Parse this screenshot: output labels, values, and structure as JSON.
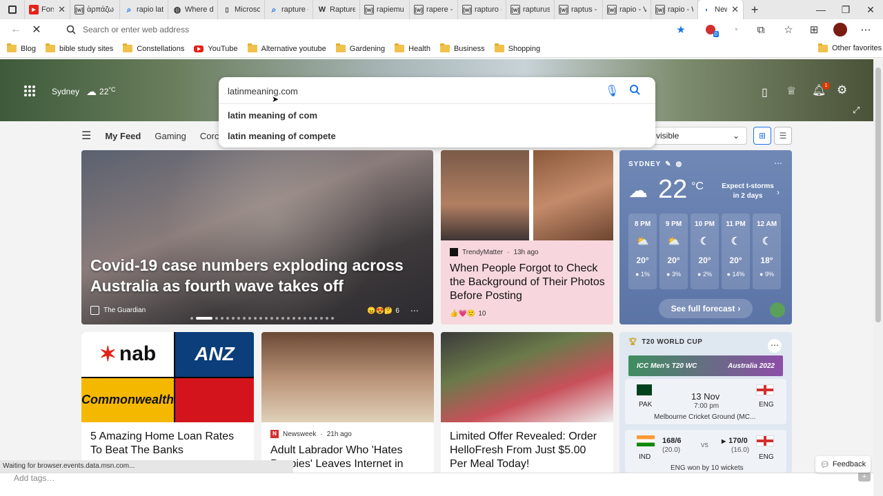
{
  "tabs": [
    {
      "icon": "youtube-icon",
      "title": "Fors",
      "color": "#e62117"
    },
    {
      "icon": "wiktionary-icon",
      "title": "ἁρπάζω"
    },
    {
      "icon": "search-icon",
      "title": "rapio lat"
    },
    {
      "icon": "globe-icon",
      "title": "Where d"
    },
    {
      "icon": "page-icon",
      "title": "Microsof"
    },
    {
      "icon": "search-icon",
      "title": "rapture -"
    },
    {
      "icon": "wikipedia-icon",
      "title": "Rapture"
    },
    {
      "icon": "wiktionary-icon",
      "title": "rapiemu"
    },
    {
      "icon": "wiktionary-icon",
      "title": "rapere -"
    },
    {
      "icon": "wiktionary-icon",
      "title": "rapturo -"
    },
    {
      "icon": "wiktionary-icon",
      "title": "rapturus"
    },
    {
      "icon": "wiktionary-icon",
      "title": "raptus -"
    },
    {
      "icon": "wiktionary-icon",
      "title": "rapio - V"
    },
    {
      "icon": "wiktionary-icon",
      "title": "rapio - W"
    }
  ],
  "active_tab": {
    "title": "New",
    "close": "✕"
  },
  "new_tab": "+",
  "window": {
    "minimize": "—",
    "restore": "❐",
    "close": "✕"
  },
  "address": {
    "placeholder": "Search or enter web address",
    "ext_badge": "0"
  },
  "bookmarks": [
    {
      "label": "Blog",
      "icon": "folder"
    },
    {
      "label": "bible study sites",
      "icon": "folder"
    },
    {
      "label": "Constellations",
      "icon": "folder"
    },
    {
      "label": "YouTube",
      "icon": "youtube"
    },
    {
      "label": "Alternative youtube",
      "icon": "folder"
    },
    {
      "label": "Gardening",
      "icon": "folder"
    },
    {
      "label": "Health",
      "icon": "folder"
    },
    {
      "label": "Business",
      "icon": "folder"
    },
    {
      "label": "Shopping",
      "icon": "folder"
    }
  ],
  "other_favorites": "Other favorites",
  "header_weather": {
    "city": "Sydney",
    "temp": "22",
    "unit": "°C"
  },
  "notifications_badge": "1",
  "search": {
    "value": "latinmeaning.com",
    "suggestions": [
      "latin meaning of com",
      "latin meaning of compete"
    ]
  },
  "feed_nav": {
    "items": [
      "My Feed",
      "Gaming",
      "Corc"
    ],
    "visible_label": "visible"
  },
  "big_card": {
    "title": "Covid-19 case numbers exploding across Australia as fourth wave takes off",
    "source": "The Guardian",
    "reactions": "6"
  },
  "pink_card": {
    "source": "TrendyMatter",
    "time": "13h ago",
    "title": "When People Forgot to Check the Background of Their Photos Before Posting",
    "reactions": "10"
  },
  "weather_card": {
    "city": "SYDNEY",
    "temp": "22",
    "unit": "°C",
    "alert": "Expect t-storms in 2 days",
    "hours": [
      {
        "time": "8 PM",
        "temp": "20°",
        "precip": "1%"
      },
      {
        "time": "9 PM",
        "temp": "20°",
        "precip": "3%"
      },
      {
        "time": "10 PM",
        "temp": "20°",
        "precip": "2%"
      },
      {
        "time": "11 PM",
        "temp": "20°",
        "precip": "14%"
      },
      {
        "time": "12 AM",
        "temp": "18°",
        "precip": "9%"
      }
    ],
    "forecast_button": "See full forecast"
  },
  "loan_card": {
    "title": "5 Amazing Home Loan Rates To Beat The Banks",
    "logos": [
      "nab",
      "ANZ",
      "Commonwealth"
    ]
  },
  "dog_card": {
    "source": "Newsweek",
    "time": "21h ago",
    "title": "Adult Labrador Who 'Hates Puppies' Leaves Internet in"
  },
  "food_card": {
    "title": "Limited Offer Revealed: Order HelloFresh From Just $5.00 Per Meal Today!"
  },
  "cricket": {
    "header": "T20 WORLD CUP",
    "banner_left": "ICC Men's T20 WC",
    "banner_right": "Australia 2022",
    "match1": {
      "team1": "PAK",
      "team2": "ENG",
      "date": "13 Nov",
      "time": "7:00 pm",
      "venue": "Melbourne Cricket Ground (MC..."
    },
    "match2": {
      "team1": "IND",
      "score1": "168/6",
      "overs1": "(20.0)",
      "vs": "VS",
      "team2": "ENG",
      "score2": "170/0",
      "overs2": "(16.0)",
      "result": "ENG won by 10 wickets"
    }
  },
  "status": "Waiting for browser.events.data.msn.com...",
  "tags_placeholder": "Add tags…",
  "feedback": "Feedback"
}
